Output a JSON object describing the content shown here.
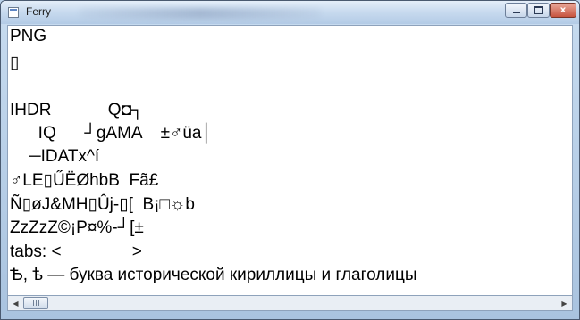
{
  "window": {
    "title": "Ferry",
    "controls": {
      "minimize": "",
      "maximize": "",
      "close": "x"
    }
  },
  "content": {
    "lines": [
      "PNG",
      "▯",
      "",
      "IHDR            Q◘┐",
      "      IQ      ┘gAMA    ±♂üa│",
      "    ─IDATx^í",
      "♂LE▯ŰËØhbB  Fã£",
      "Ñ▯øJ&MH▯Ûj-▯[  B¡□☼b",
      "ZzZzZ©¡P¤%-┘[±",
      "tabs: <               >",
      "Ѣ, ѣ — буква исторической кириллицы и глаголицы"
    ]
  },
  "scrollbar": {
    "left_arrow": "◀",
    "right_arrow": "▶"
  }
}
